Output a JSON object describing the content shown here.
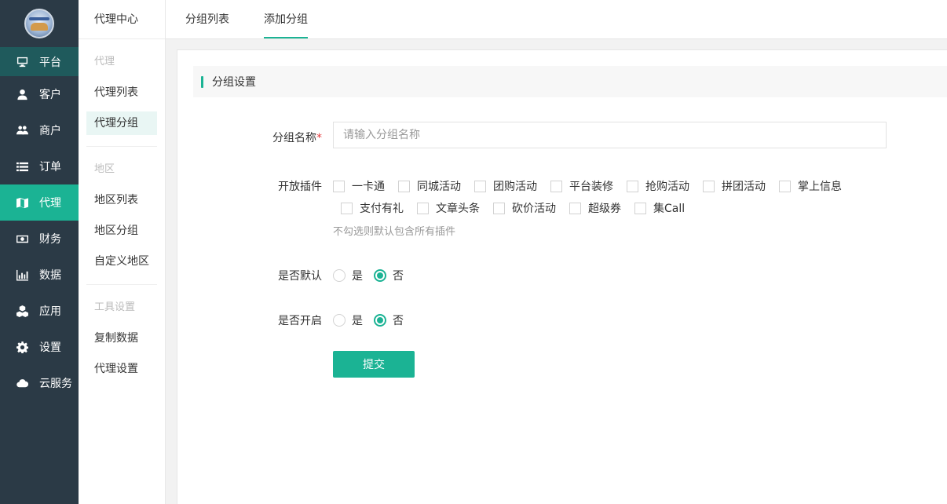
{
  "sidebar": {
    "items": [
      {
        "label": "平台",
        "icon": "monitor-icon"
      },
      {
        "label": "客户",
        "icon": "user-icon"
      },
      {
        "label": "商户",
        "icon": "users-icon"
      },
      {
        "label": "订单",
        "icon": "list-icon"
      },
      {
        "label": "代理",
        "icon": "map-icon"
      },
      {
        "label": "财务",
        "icon": "money-icon"
      },
      {
        "label": "数据",
        "icon": "bar-chart-icon"
      },
      {
        "label": "应用",
        "icon": "cubes-icon"
      },
      {
        "label": "设置",
        "icon": "gear-icon"
      },
      {
        "label": "云服务",
        "icon": "cloud-icon"
      }
    ]
  },
  "subnav": {
    "title": "代理中心",
    "group1": "代理",
    "group1_items": [
      "代理列表",
      "代理分组"
    ],
    "group2": "地区",
    "group2_items": [
      "地区列表",
      "地区分组",
      "自定义地区"
    ],
    "group3": "工具设置",
    "group3_items": [
      "复制数据",
      "代理设置"
    ]
  },
  "tabs": [
    "分组列表",
    "添加分组"
  ],
  "section_title": "分组设置",
  "form": {
    "name_label": "分组名称",
    "name_required": "*",
    "name_placeholder": "请输入分组名称",
    "plugins_label": "开放插件",
    "plugins_row1": [
      "一卡通",
      "同城活动",
      "团购活动",
      "平台装修",
      "抢购活动",
      "拼团活动",
      "掌上信息"
    ],
    "plugins_row2": [
      "支付有礼",
      "文章头条",
      "砍价活动",
      "超级券",
      "集Call"
    ],
    "plugins_hint": "不勾选则默认包含所有插件",
    "default_label": "是否默认",
    "open_label": "是否开启",
    "yes": "是",
    "no": "否",
    "submit": "提交"
  },
  "colors": {
    "accent": "#1bb394",
    "sidebar_bg": "#2b3a46",
    "platform_bg": "#1f5a5c"
  }
}
